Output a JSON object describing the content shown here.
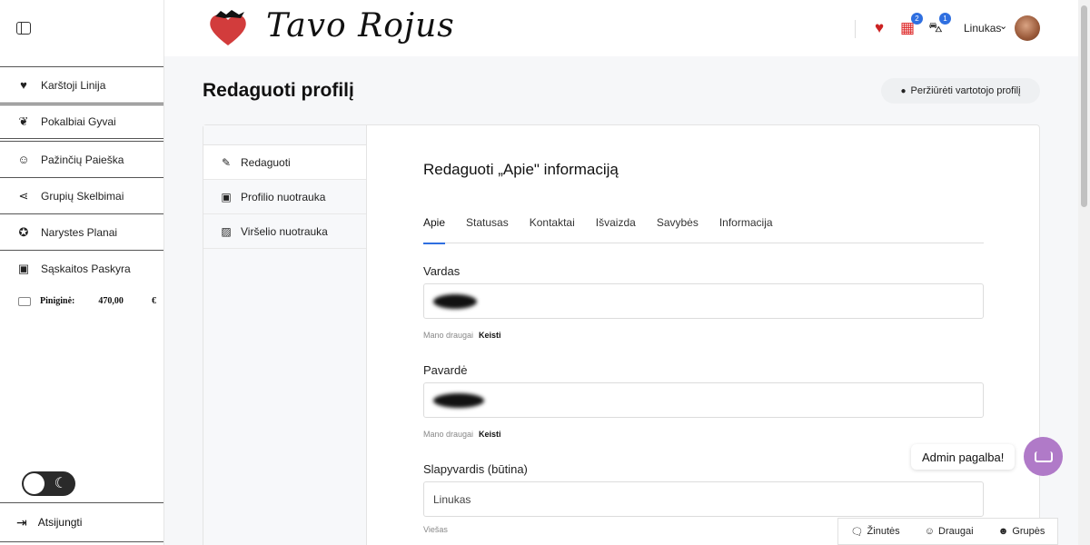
{
  "sidebar": {
    "items": [
      {
        "label": "Karštoji Linija",
        "icon": "heart-fire-icon"
      },
      {
        "label": "Pokalbiai Gyvai",
        "icon": "hearts-icon"
      },
      {
        "label": "Pažinčių Paieška",
        "icon": "users-icon"
      },
      {
        "label": "Grupių Skelbimai",
        "icon": "share-icon"
      },
      {
        "label": "Narystes Planai",
        "icon": "award-icon"
      },
      {
        "label": "Sąskaitos Paskyra",
        "icon": "account-icon"
      }
    ],
    "wallet": {
      "label": "Piniginė:",
      "amount": "470,00",
      "currency": "€"
    },
    "logout": "Atsijungti"
  },
  "header": {
    "logo_text": "Tavo Rojus",
    "badges": {
      "gifts": "2",
      "cart": "1"
    },
    "user_name": "Linukas"
  },
  "page": {
    "title": "Redaguoti profilį",
    "view_profile_button": "Peržiūrėti vartotojo profilį"
  },
  "side_nav": [
    {
      "label": "Redaguoti",
      "icon": "edit-icon"
    },
    {
      "label": "Profilio nuotrauka",
      "icon": "portrait-icon"
    },
    {
      "label": "Viršelio nuotrauka",
      "icon": "image-icon"
    }
  ],
  "form": {
    "title": "Redaguoti „Apie\" informaciją",
    "tabs": [
      "Apie",
      "Statusas",
      "Kontaktai",
      "Išvaizda",
      "Savybės",
      "Informacija"
    ],
    "fields": [
      {
        "label": "Vardas",
        "note": "Mano draugai",
        "note_action": "Keisti"
      },
      {
        "label": "Pavardė",
        "note": "Mano draugai",
        "note_action": "Keisti"
      },
      {
        "label": "Slapyvardis (būtina)",
        "value": "Linukas",
        "note": "Viešas"
      }
    ]
  },
  "chat": {
    "bubble": "Admin pagalba!"
  },
  "bottom_bar": [
    "Žinutės",
    "Draugai",
    "Grupės"
  ],
  "colors": {
    "accent": "#2f6fe0",
    "chat": "#b07ac8",
    "logo_heart": "#d23c3c"
  }
}
